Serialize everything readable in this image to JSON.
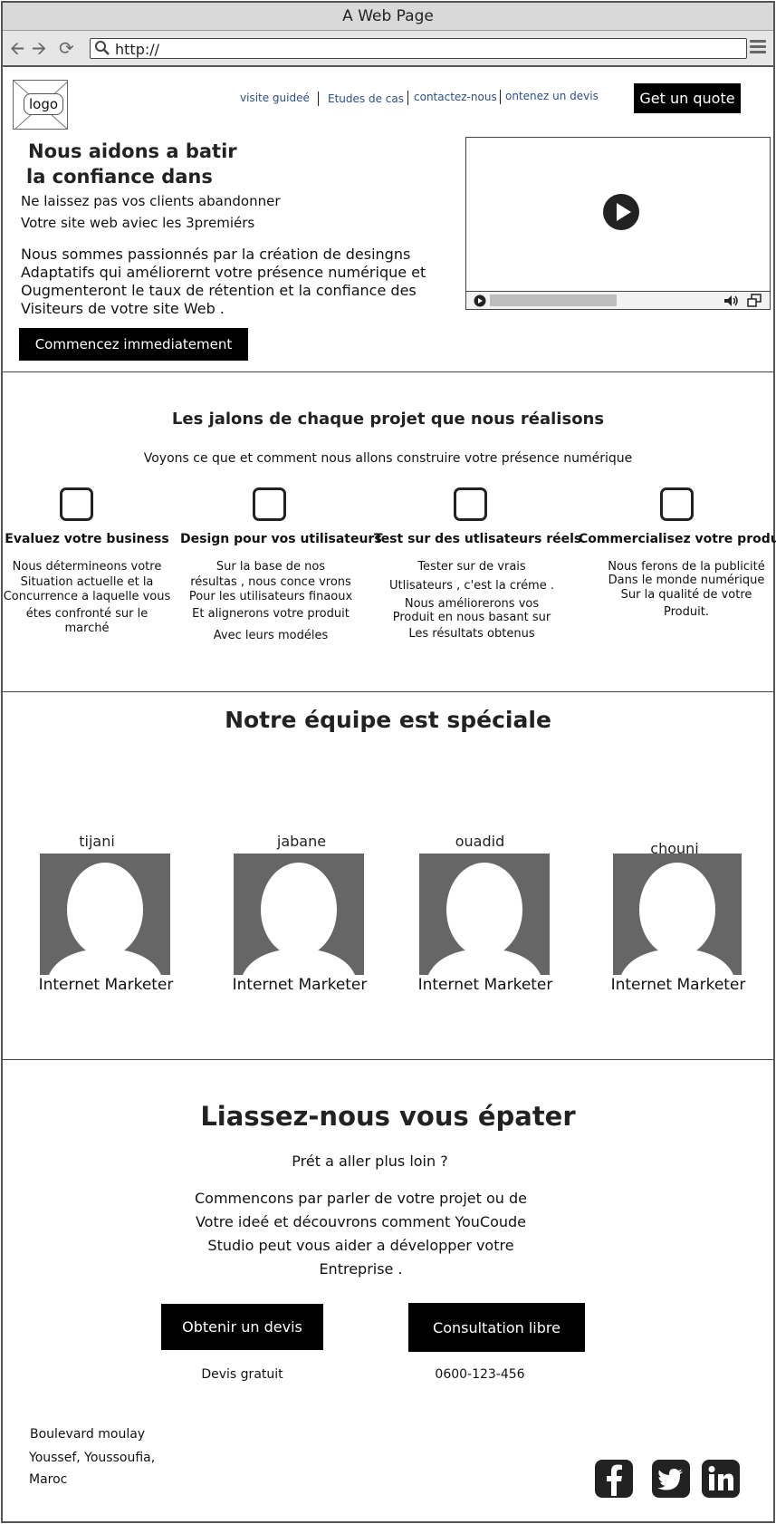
{
  "window": {
    "title": "A Web Page"
  },
  "browser": {
    "url": "http://"
  },
  "header": {
    "logo": "logo",
    "nav": [
      {
        "label": "visite guideé"
      },
      {
        "label": "Etudes de cas"
      },
      {
        "label": "contactez-nous"
      },
      {
        "label": "ontenez un devis"
      }
    ],
    "quote_button": "Get un quote"
  },
  "hero": {
    "title_line1": "Nous aidons a batir",
    "title_line2": "la confiance dans",
    "line1": "Ne laissez pas vos clients abandonner",
    "line2": "Votre site web aviec les 3premiérs",
    "para": [
      "Nous sommes passionnés par la création de desingns",
      "Adaptatifs qui améliorernt votre présence numérique et",
      "Ougmenteront le taux de rétention et la confiance des",
      "Visiteurs de votre site Web ."
    ],
    "cta": "Commencez immediatement"
  },
  "milestones": {
    "title": "Les jalons de chaque projet que nous réalisons",
    "subtitle": "Voyons ce que et comment nous allons construire votre présence numérique",
    "columns": [
      {
        "title": "Evaluez votre business",
        "lines": [
          "Nous détermineons votre",
          "Situation actuelle et la",
          "Concurrence a laquelle vous",
          "étes confronté sur le",
          "marché"
        ]
      },
      {
        "title": "Design pour vos utilisateurs",
        "lines": [
          "Sur la base de nos",
          "résultas , nous conce vrons",
          "Pour les utilisateurs finaoux",
          "Et alignerons votre produit",
          "Avec leurs modéles"
        ]
      },
      {
        "title": "Test sur des utlisateurs réels",
        "lines": [
          "Tester sur de vrais",
          "Utlisateurs , c'est la créme .",
          "Nous améliorerons vos",
          "Produit en nous basant sur",
          "Les résultats obtenus"
        ]
      },
      {
        "title": "Commercialisez votre produit",
        "lines": [
          "Nous ferons de la publicité",
          "Dans le monde numérique",
          "Sur la qualité de votre",
          "Produit."
        ]
      }
    ]
  },
  "team": {
    "title": "Notre équipe est spéciale",
    "members": [
      {
        "name": "tijani",
        "role": "Internet Marketer"
      },
      {
        "name": "jabane",
        "role": "Internet Marketer"
      },
      {
        "name": "ouadid",
        "role": "Internet Marketer"
      },
      {
        "name": "chouni",
        "role": "Internet Marketer"
      }
    ]
  },
  "cta": {
    "title": "Liassez-nous vous épater",
    "subtitle": "Prét a aller plus loin ?",
    "para": [
      "Commencons par parler de votre projet ou de",
      "Votre ideé et découvrons comment YouCoude",
      "Studio peut vous aider a développer votre",
      "Entreprise ."
    ],
    "button1": "Obtenir un devis",
    "button1_note": "Devis gratuit",
    "button2": "Consultation libre",
    "button2_note": "0600-123-456"
  },
  "footer": {
    "address": [
      "Boulevard moulay",
      "Youssef, Youssoufia,",
      "Maroc"
    ],
    "social": [
      {
        "icon": "facebook-icon"
      },
      {
        "icon": "twitter-icon"
      },
      {
        "icon": "linkedin-icon"
      }
    ]
  },
  "colors": {
    "button_bg": "#000000",
    "avatar_bg": "#666666",
    "link": "#2a4f8a"
  }
}
